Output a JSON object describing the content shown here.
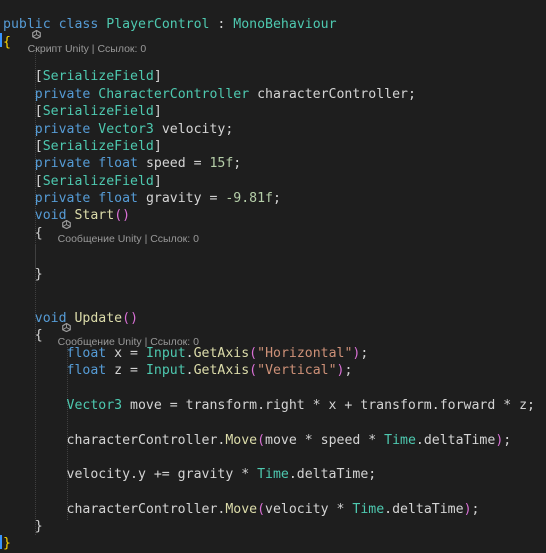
{
  "colors": {
    "background": "#1e1e1e",
    "keyword": "#569cd6",
    "type": "#4ec9b0",
    "identifier": "#d4d4d4",
    "number": "#b5cea8",
    "string": "#ce9178",
    "method": "#dcdcaa",
    "brace": "#ffd700",
    "paren": "#da70d6",
    "codelens": "#999999"
  },
  "codelens_icon": "unity-icon",
  "codelens": {
    "class": "Скрипт Unity | Ссылок: 0",
    "start": "Сообщение Unity | Ссылок: 0",
    "update": "Сообщение Unity | Ссылок: 0"
  },
  "code_lines": [
    {
      "indent": "",
      "tokens": [
        [
          "kw",
          "public"
        ],
        [
          "id",
          " "
        ],
        [
          "kw",
          "class"
        ],
        [
          "id",
          " "
        ],
        [
          "type",
          "PlayerControl"
        ],
        [
          "id",
          " : "
        ],
        [
          "type",
          "MonoBehaviour"
        ]
      ]
    },
    {
      "indent": "",
      "tokens": [
        [
          "brace",
          "{"
        ]
      ]
    },
    {
      "indent": "",
      "tokens": []
    },
    {
      "indent": "    ",
      "tokens": [
        [
          "id",
          "["
        ],
        [
          "type",
          "SerializeField"
        ],
        [
          "id",
          "]"
        ]
      ]
    },
    {
      "indent": "    ",
      "tokens": [
        [
          "kw",
          "private"
        ],
        [
          "id",
          " "
        ],
        [
          "type",
          "CharacterController"
        ],
        [
          "id",
          " characterController;"
        ]
      ]
    },
    {
      "indent": "    ",
      "tokens": [
        [
          "id",
          "["
        ],
        [
          "type",
          "SerializeField"
        ],
        [
          "id",
          "]"
        ]
      ]
    },
    {
      "indent": "    ",
      "tokens": [
        [
          "kw",
          "private"
        ],
        [
          "id",
          " "
        ],
        [
          "type",
          "Vector3"
        ],
        [
          "id",
          " velocity;"
        ]
      ]
    },
    {
      "indent": "    ",
      "tokens": [
        [
          "id",
          "["
        ],
        [
          "type",
          "SerializeField"
        ],
        [
          "id",
          "]"
        ]
      ]
    },
    {
      "indent": "    ",
      "tokens": [
        [
          "kw",
          "private"
        ],
        [
          "id",
          " "
        ],
        [
          "kw",
          "float"
        ],
        [
          "id",
          " speed = "
        ],
        [
          "num",
          "15f"
        ],
        [
          "id",
          ";"
        ]
      ]
    },
    {
      "indent": "    ",
      "tokens": [
        [
          "id",
          "["
        ],
        [
          "type",
          "SerializeField"
        ],
        [
          "id",
          "]"
        ]
      ]
    },
    {
      "indent": "    ",
      "tokens": [
        [
          "kw",
          "private"
        ],
        [
          "id",
          " "
        ],
        [
          "kw",
          "float"
        ],
        [
          "id",
          " gravity = "
        ],
        [
          "num",
          "-9.81f"
        ],
        [
          "id",
          ";"
        ]
      ]
    },
    {
      "indent": "    ",
      "tokens": [
        [
          "kw",
          "void"
        ],
        [
          "id",
          " "
        ],
        [
          "meth",
          "Start"
        ],
        [
          "paren",
          "()"
        ]
      ]
    },
    {
      "indent": "    ",
      "tokens": [
        [
          "id",
          "{"
        ]
      ]
    },
    {
      "indent": "",
      "tokens": []
    },
    {
      "indent": "    ",
      "tokens": [
        [
          "id",
          "}"
        ]
      ]
    },
    {
      "indent": "",
      "tokens": []
    },
    {
      "indent": "    ",
      "tokens": [
        [
          "kw",
          "void"
        ],
        [
          "id",
          " "
        ],
        [
          "meth",
          "Update"
        ],
        [
          "paren",
          "()"
        ]
      ]
    },
    {
      "indent": "    ",
      "tokens": [
        [
          "id",
          "{"
        ]
      ]
    },
    {
      "indent": "        ",
      "tokens": [
        [
          "kw",
          "float"
        ],
        [
          "id",
          " x = "
        ],
        [
          "type",
          "Input"
        ],
        [
          "id",
          "."
        ],
        [
          "meth",
          "GetAxis"
        ],
        [
          "paren",
          "("
        ],
        [
          "str",
          "\"Horizontal\""
        ],
        [
          "paren",
          ")"
        ],
        [
          "id",
          ";"
        ]
      ]
    },
    {
      "indent": "        ",
      "tokens": [
        [
          "kw",
          "float"
        ],
        [
          "id",
          " z = "
        ],
        [
          "type",
          "Input"
        ],
        [
          "id",
          "."
        ],
        [
          "meth",
          "GetAxis"
        ],
        [
          "paren",
          "("
        ],
        [
          "str",
          "\"Vertical\""
        ],
        [
          "paren",
          ")"
        ],
        [
          "id",
          ";"
        ]
      ]
    },
    {
      "indent": "",
      "tokens": []
    },
    {
      "indent": "        ",
      "tokens": [
        [
          "type",
          "Vector3"
        ],
        [
          "id",
          " move = transform.right * x + transform.forward * z;"
        ]
      ]
    },
    {
      "indent": "",
      "tokens": []
    },
    {
      "indent": "        ",
      "tokens": [
        [
          "id",
          "characterController."
        ],
        [
          "meth",
          "Move"
        ],
        [
          "paren",
          "("
        ],
        [
          "id",
          "move * speed * "
        ],
        [
          "type",
          "Time"
        ],
        [
          "id",
          ".deltaTime"
        ],
        [
          "paren",
          ")"
        ],
        [
          "id",
          ";"
        ]
      ]
    },
    {
      "indent": "",
      "tokens": []
    },
    {
      "indent": "        ",
      "tokens": [
        [
          "id",
          "velocity.y += gravity * "
        ],
        [
          "type",
          "Time"
        ],
        [
          "id",
          ".deltaTime;"
        ]
      ]
    },
    {
      "indent": "",
      "tokens": []
    },
    {
      "indent": "        ",
      "tokens": [
        [
          "id",
          "characterController."
        ],
        [
          "meth",
          "Move"
        ],
        [
          "paren",
          "("
        ],
        [
          "id",
          "velocity * "
        ],
        [
          "type",
          "Time"
        ],
        [
          "id",
          ".deltaTime"
        ],
        [
          "paren",
          ")"
        ],
        [
          "id",
          ";"
        ]
      ]
    },
    {
      "indent": "    ",
      "tokens": [
        [
          "id",
          "}"
        ]
      ]
    },
    {
      "indent": "",
      "tokens": [
        [
          "brace",
          "}"
        ]
      ]
    }
  ]
}
